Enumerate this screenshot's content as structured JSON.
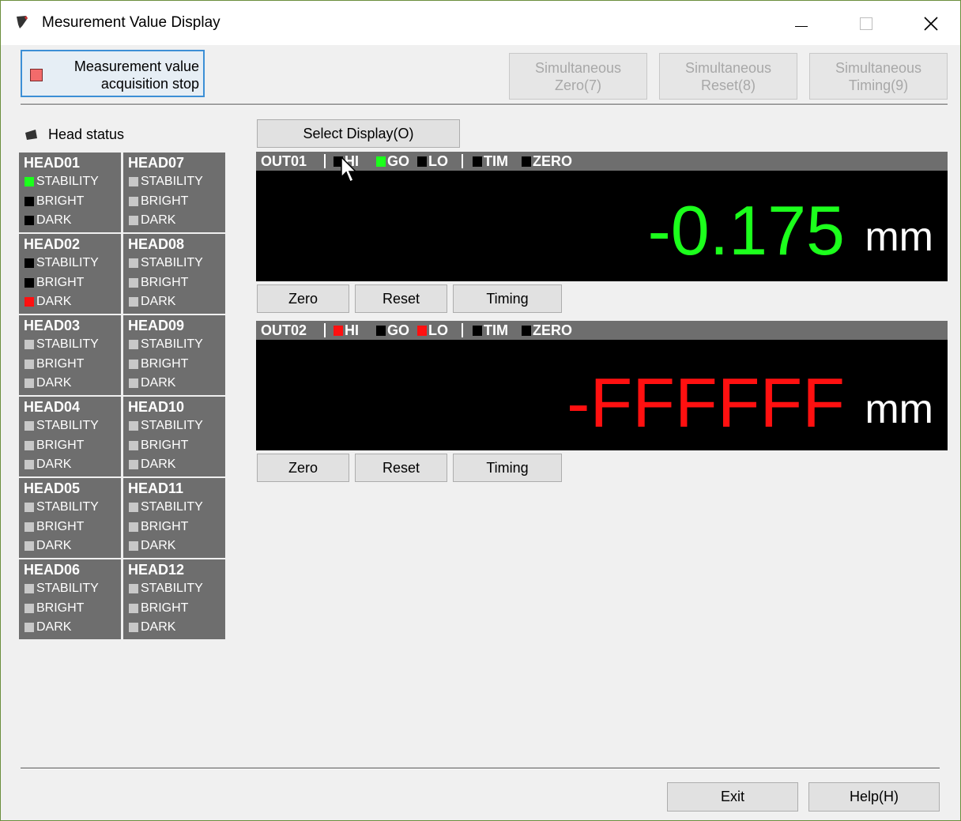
{
  "window": {
    "title": "Mesurement Value Display"
  },
  "toolbar": {
    "stop_label_line1": "Measurement value",
    "stop_label_line2": "acquisition stop",
    "sim_zero_line1": "Simultaneous",
    "sim_zero_line2": "Zero(7)",
    "sim_reset_line1": "Simultaneous",
    "sim_reset_line2": "Reset(8)",
    "sim_timing_line1": "Simultaneous",
    "sim_timing_line2": "Timing(9)"
  },
  "head_status": {
    "label": "Head status",
    "heads": [
      {
        "name": "HEAD01",
        "stability": "STABILITY",
        "bright": "BRIGHT",
        "dark": "DARK"
      },
      {
        "name": "HEAD02",
        "stability": "STABILITY",
        "bright": "BRIGHT",
        "dark": "DARK"
      },
      {
        "name": "HEAD03",
        "stability": "STABILITY",
        "bright": "BRIGHT",
        "dark": "DARK"
      },
      {
        "name": "HEAD04",
        "stability": "STABILITY",
        "bright": "BRIGHT",
        "dark": "DARK"
      },
      {
        "name": "HEAD05",
        "stability": "STABILITY",
        "bright": "BRIGHT",
        "dark": "DARK"
      },
      {
        "name": "HEAD06",
        "stability": "STABILITY",
        "bright": "BRIGHT",
        "dark": "DARK"
      },
      {
        "name": "HEAD07",
        "stability": "STABILITY",
        "bright": "BRIGHT",
        "dark": "DARK"
      },
      {
        "name": "HEAD08",
        "stability": "STABILITY",
        "bright": "BRIGHT",
        "dark": "DARK"
      },
      {
        "name": "HEAD09",
        "stability": "STABILITY",
        "bright": "BRIGHT",
        "dark": "DARK"
      },
      {
        "name": "HEAD10",
        "stability": "STABILITY",
        "bright": "BRIGHT",
        "dark": "DARK"
      },
      {
        "name": "HEAD11",
        "stability": "STABILITY",
        "bright": "BRIGHT",
        "dark": "DARK"
      },
      {
        "name": "HEAD12",
        "stability": "STABILITY",
        "bright": "BRIGHT",
        "dark": "DARK"
      }
    ]
  },
  "select_display_label": "Select Display(O)",
  "outputs": [
    {
      "name": "OUT01",
      "hi": "HI",
      "go": "GO",
      "lo": "LO",
      "tim": "TIM",
      "zero": "ZERO",
      "value": "-0.175",
      "unit": "mm",
      "zero_label": "Zero",
      "reset_label": "Reset",
      "timing_label": "Timing"
    },
    {
      "name": "OUT02",
      "hi": "HI",
      "go": "GO",
      "lo": "LO",
      "tim": "TIM",
      "zero": "ZERO",
      "value": "-FFFFFF",
      "unit": "mm",
      "zero_label": "Zero",
      "reset_label": "Reset",
      "timing_label": "Timing"
    }
  ],
  "footer": {
    "exit_label": "Exit",
    "help_label": "Help(H)"
  },
  "colors": {
    "green": "#1cff1c",
    "red": "#ff1010",
    "black": "#000000",
    "grey": "#c8c8c8",
    "panel": "#6e6e6e",
    "accent": "#3c8fd6"
  }
}
